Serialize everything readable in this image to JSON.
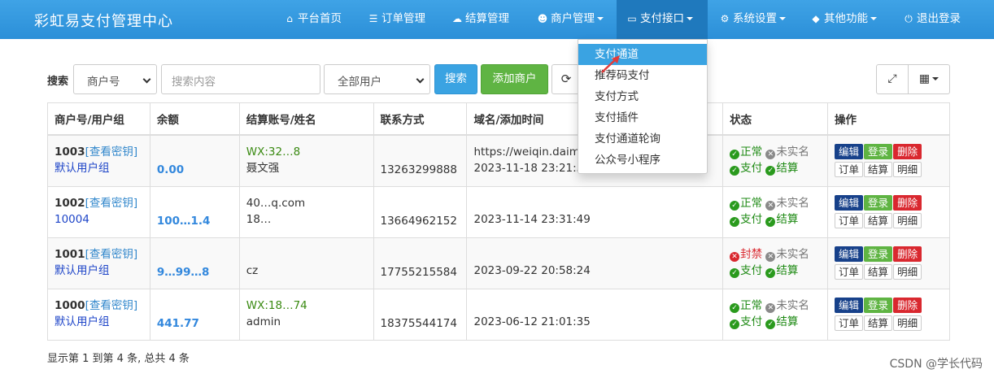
{
  "navbar": {
    "brand": "彩虹易支付管理中心",
    "items": [
      {
        "icon": "home-icon",
        "glyph": "⌂",
        "label": "平台首页"
      },
      {
        "icon": "list-icon",
        "glyph": "☰",
        "label": "订单管理"
      },
      {
        "icon": "cloud-icon",
        "glyph": "☁",
        "label": "结算管理"
      },
      {
        "icon": "user-icon",
        "glyph": "👤",
        "label": "商户管理"
      },
      {
        "icon": "card-icon",
        "glyph": "▭",
        "label": "支付接口"
      },
      {
        "icon": "gear-icon",
        "glyph": "⚙",
        "label": "系统设置"
      },
      {
        "icon": "cube-icon",
        "glyph": "◆",
        "label": "其他功能"
      },
      {
        "icon": "power-icon",
        "glyph": "⏻",
        "label": "退出登录"
      }
    ]
  },
  "dropdown": {
    "items": [
      "支付通道",
      "推荐码支付",
      "支付方式",
      "支付插件",
      "支付通道轮询",
      "公众号小程序"
    ]
  },
  "toolbar": {
    "search_label": "搜索",
    "field_select": "商户号",
    "search_placeholder": "搜索内容",
    "user_select": "全部用户",
    "search_button": "搜索",
    "add_button": "添加商户",
    "refresh_icon": "refresh-icon",
    "fullscreen_icon": "fullscreen-icon",
    "columns_icon": "grid-icon"
  },
  "table": {
    "headers": [
      "商户号/用户组",
      "余额",
      "结算账号/姓名",
      "联系方式",
      "域名/添加时间",
      "状态",
      "操作"
    ],
    "view_key": "[查看密钥]",
    "rows": [
      {
        "uid": "1003",
        "group": "默认用户组",
        "balance": "0.00",
        "account": "WX:32…8",
        "name": "聂文强",
        "phone": "13263299888",
        "domain": "https://weiqin.daimac",
        "time": "2023-11-18 23:21:57",
        "status": "正常",
        "status_ok": true
      },
      {
        "uid": "1002",
        "group": "10004",
        "balance": "100…1.4",
        "account": "40…q.com",
        "name": "18…",
        "phone": "13664962152",
        "domain": "",
        "time": "2023-11-14 23:31:49",
        "status": "正常",
        "status_ok": true
      },
      {
        "uid": "1001",
        "group": "默认用户组",
        "balance": "9…99…8",
        "account": "",
        "name": "cz",
        "phone": "17755215584",
        "domain": "",
        "time": "2023-09-22 20:58:24",
        "status": "封禁",
        "status_ok": false
      },
      {
        "uid": "1000",
        "group": "默认用户组",
        "balance": "441.77",
        "account": "WX:18…74",
        "name": "admin",
        "phone": "18375544174",
        "domain": "",
        "time": "2023-06-12 21:01:35",
        "status": "正常",
        "status_ok": true
      }
    ],
    "labels": {
      "unverified": "未实名",
      "pay": "支付",
      "settle": "结算",
      "edit": "编辑",
      "login": "登录",
      "delete": "删除",
      "orders": "订单",
      "settlement": "结算",
      "detail": "明细"
    }
  },
  "footer": "显示第 1 到第 4 条, 总共 4 条",
  "watermark": "CSDN @学长代码",
  "colors": {
    "nav_bg": "#2b8fd8",
    "primary": "#3aa3e2",
    "success": "#5fb443",
    "danger": "#d9282f",
    "edit": "#17418a"
  }
}
